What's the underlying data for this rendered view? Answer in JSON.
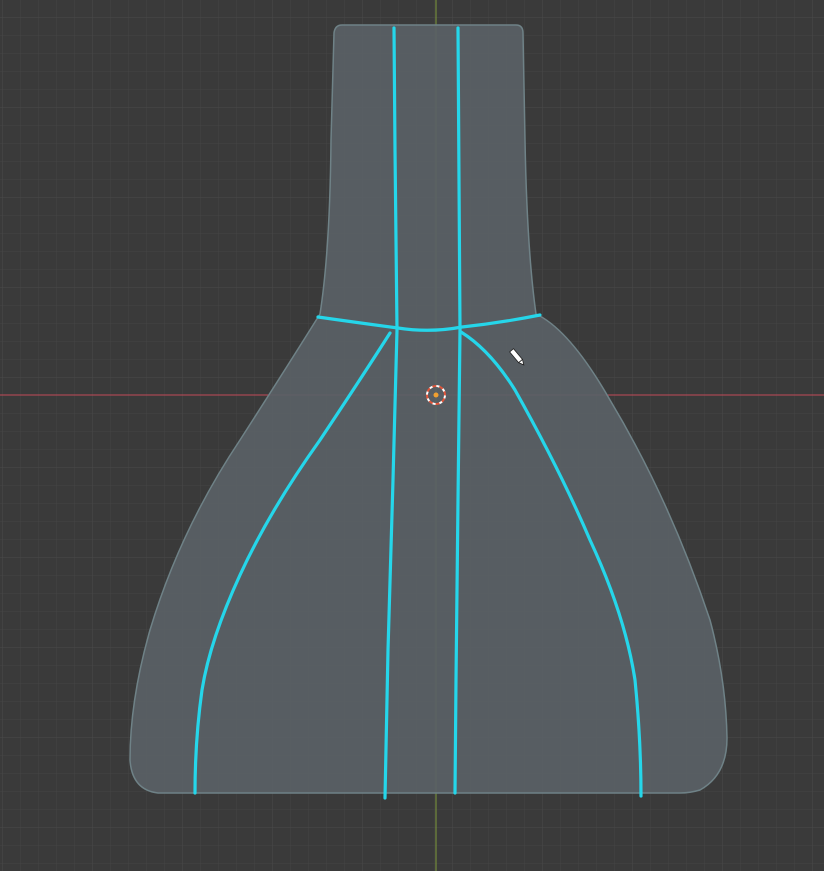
{
  "viewport": {
    "background_color": "#3a3a3a",
    "grid_minor_color": "#444444",
    "grid_major_color": "#4d4d4d",
    "x_axis_color": "#c24a58",
    "y_axis_color": "#7e9a3a",
    "mesh_fill_color": "#5c6368",
    "mesh_outline_color": "#76878c",
    "stroke_color": "#25d6ea",
    "cursor_icon": "pencil-icon",
    "origin_icon": "3d-cursor-icon"
  }
}
